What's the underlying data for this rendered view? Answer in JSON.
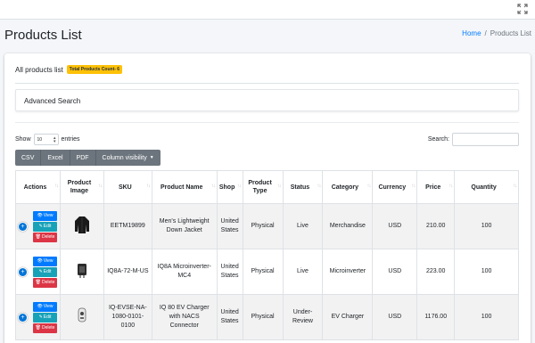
{
  "page": {
    "title": "Products List",
    "breadcrumb": {
      "home": "Home",
      "separator": "/",
      "current": "Products List"
    }
  },
  "card": {
    "title": "All products list",
    "badge": "Total Products Count- 6"
  },
  "advanced_search": {
    "label": "Advanced Search"
  },
  "controls": {
    "show_label": "Show",
    "entries_value": "10",
    "entries_label": "entries",
    "search_label": "Search:"
  },
  "toolbar": {
    "csv": "CSV",
    "excel": "Excel",
    "pdf": "PDF",
    "column_visibility": "Column visibility"
  },
  "table": {
    "headers": [
      "Actions",
      "Product Image",
      "SKU",
      "Product Name",
      "Shop",
      "Product Type",
      "Status",
      "Category",
      "Currency",
      "Price",
      "Quantity"
    ],
    "action_labels": {
      "view": "View",
      "edit": "Edit",
      "delete": "Delete"
    },
    "rows": [
      {
        "sku": "EETM19899",
        "name": "Men's Lightweight Down Jacket",
        "shop": "United States",
        "type": "Physical",
        "status": "Live",
        "category": "Merchandise",
        "currency": "USD",
        "price": "210.00",
        "quantity": "100",
        "image_icon": "jacket-image"
      },
      {
        "sku": "IQ8A-72-M-US",
        "name": "IQ8A Microinverter-MC4",
        "shop": "United States",
        "type": "Physical",
        "status": "Live",
        "category": "Microinverter",
        "currency": "USD",
        "price": "223.00",
        "quantity": "100",
        "image_icon": "microinverter-image"
      },
      {
        "sku": "IQ-EVSE-NA-1080-0101-0100",
        "name": "IQ 80 EV Charger with NACS Connector",
        "shop": "United States",
        "type": "Physical",
        "status": "Under-Review",
        "category": "EV Charger",
        "currency": "USD",
        "price": "1176.00",
        "quantity": "100",
        "image_icon": "ev-charger-image"
      }
    ]
  },
  "colors": {
    "view": "#007bff",
    "edit": "#17a2b8",
    "delete": "#dc3545",
    "badge": "#ffc107",
    "toolbar": "#6c757d",
    "link": "#007bff"
  }
}
